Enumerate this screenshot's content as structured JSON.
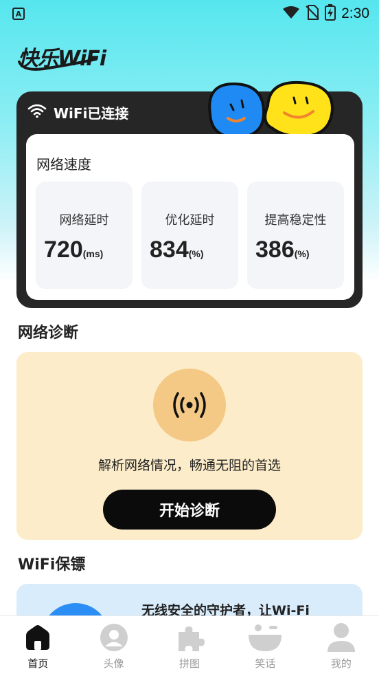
{
  "status_bar": {
    "time": "2:30",
    "app_badge": "A"
  },
  "logo": {
    "text": "快乐WiFi"
  },
  "connection": {
    "status": "WiFi已连接",
    "speed_title": "网络速度",
    "metrics": [
      {
        "label": "网络延时",
        "value": "720",
        "unit": "(ms)"
      },
      {
        "label": "优化延时",
        "value": "834",
        "unit": "(%)"
      },
      {
        "label": "提高稳定性",
        "value": "386",
        "unit": "(%)"
      }
    ]
  },
  "diagnosis": {
    "section_title": "网络诊断",
    "description": "解析网络情况，畅通无阻的首选",
    "button_label": "开始诊断"
  },
  "guard": {
    "section_title": "WiFi保镖",
    "description": "无线安全的守护者，让Wi-Fi"
  },
  "nav": {
    "items": [
      {
        "label": "首页",
        "icon": "home-icon",
        "active": true
      },
      {
        "label": "头像",
        "icon": "avatar-icon",
        "active": false
      },
      {
        "label": "拼图",
        "icon": "puzzle-icon",
        "active": false
      },
      {
        "label": "笑话",
        "icon": "laugh-icon",
        "active": false
      },
      {
        "label": "我的",
        "icon": "profile-icon",
        "active": false
      }
    ]
  },
  "colors": {
    "accent_dark": "#262626",
    "diag_bg": "#fcecc9",
    "diag_icon_bg": "#f4c985",
    "guard_bg": "#d9ecfb",
    "header_gradient_top": "#56e6ee"
  }
}
